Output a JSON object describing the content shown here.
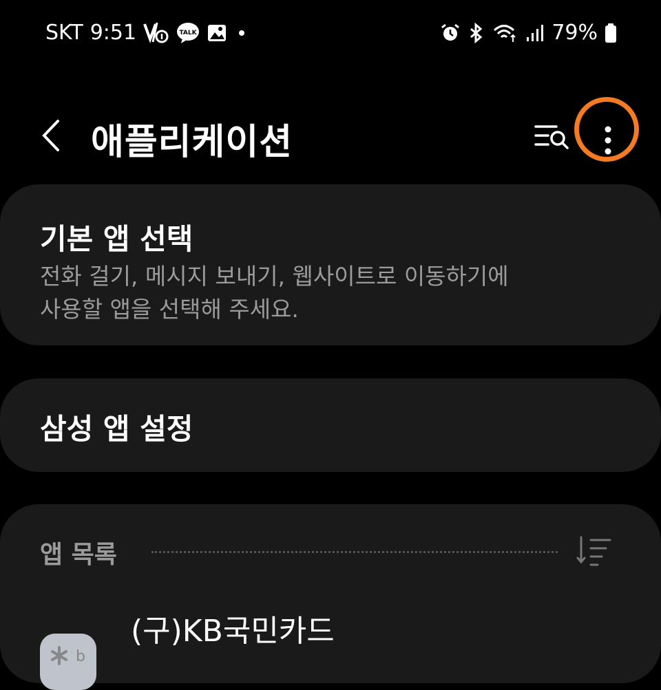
{
  "status_bar": {
    "carrier": "SKT",
    "time": "9:51",
    "battery": "79%"
  },
  "app_bar": {
    "title": "애플리케이션"
  },
  "default_apps": {
    "title": "기본 앱 선택",
    "description": "전화 걸기, 메시지 보내기, 웹사이트로 이동하기에\n사용할 앱을 선택해 주세요."
  },
  "samsung_settings": {
    "title": "삼성 앱 설정"
  },
  "app_list": {
    "section_label": "앱 목록",
    "apps": [
      {
        "name": "(구)KB국민카드"
      }
    ]
  },
  "colors": {
    "background": "#000000",
    "card": "#1a1a1a",
    "secondary_text": "#9b9b9b",
    "highlight_ring": "#f47b21"
  }
}
